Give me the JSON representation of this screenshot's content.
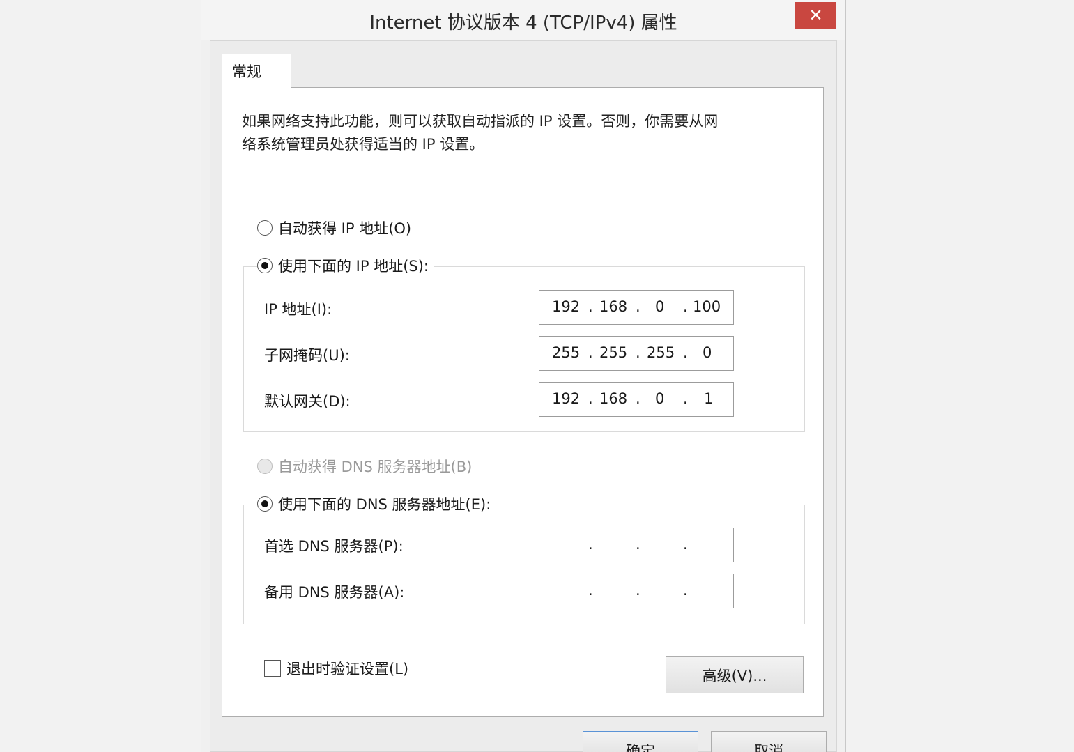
{
  "window": {
    "title": "Internet 协议版本 4 (TCP/IPv4) 属性",
    "close_glyph": "✕"
  },
  "tabs": [
    {
      "label": "常规",
      "selected": true
    }
  ],
  "description": {
    "line1": "如果网络支持此功能，则可以获取自动指派的 IP 设置。否则，你需要从网",
    "line2": "络系统管理员处获得适当的 IP 设置。"
  },
  "ip_mode": {
    "auto_label": "自动获得 IP 地址(O)",
    "manual_label": "使用下面的 IP 地址(S):",
    "selected": "manual"
  },
  "ip_fields": {
    "ip_address": {
      "label": "IP 地址(I):",
      "octets": [
        "192",
        "168",
        "0",
        "100"
      ]
    },
    "subnet_mask": {
      "label": "子网掩码(U):",
      "octets": [
        "255",
        "255",
        "255",
        "0"
      ]
    },
    "default_gateway": {
      "label": "默认网关(D):",
      "octets": [
        "192",
        "168",
        "0",
        "1"
      ]
    }
  },
  "dns_mode": {
    "auto_label": "自动获得 DNS 服务器地址(B)",
    "manual_label": "使用下面的 DNS 服务器地址(E):",
    "selected": "manual",
    "auto_disabled": true
  },
  "dns_fields": {
    "preferred": {
      "label": "首选 DNS 服务器(P):",
      "octets": [
        "",
        "",
        "",
        ""
      ]
    },
    "alternate": {
      "label": "备用 DNS 服务器(A):",
      "octets": [
        "",
        "",
        "",
        ""
      ]
    }
  },
  "validate_checkbox": {
    "label": "退出时验证设置(L)",
    "checked": false
  },
  "buttons": {
    "advanced": "高级(V)...",
    "ok": "确定",
    "cancel": "取消"
  },
  "colors": {
    "close_button": "#c94740",
    "dialog_bg": "#f0f0f0",
    "panel_bg": "#ffffff"
  }
}
